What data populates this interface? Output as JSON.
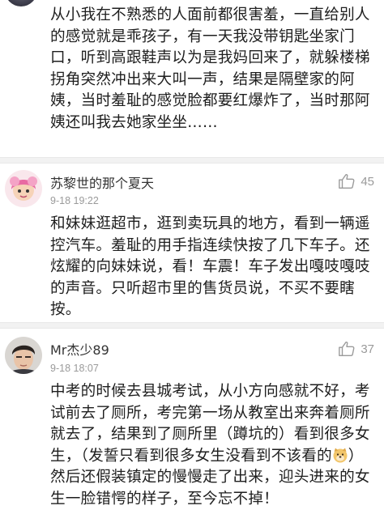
{
  "comments": [
    {
      "text": "从小我在不熟悉的人面前都很害羞，一直给别人的感觉就是乖孩子，有一天我没带钥匙坐家门口，听到高跟鞋声以为是我妈回来了，就躲楼梯拐角突然冲出来大叫一声，结果是隔壁家的阿姨，当时羞耻的感觉脸都要红爆炸了，当时那阿姨还叫我去她家坐坐……"
    },
    {
      "username": "苏黎世的那个夏天",
      "time": "9-18 19:22",
      "likes": "45",
      "text": "和妹妹逛超市，逛到卖玩具的地方，看到一辆遥控汽车。羞耻的用手指连续快按了几下车子。还炫耀的向妹妹说，看！车震！车子发出嘎吱嘎吱的声音。只听超市里的售货员说，不买不要瞎按。"
    },
    {
      "username": "Mr杰少89",
      "time": "9-18 18:07",
      "likes": "37",
      "text_before_emoji": "中考的时候去县城考试，从小方向感就不好，考试前去了厕所，考完第一场从教室出来奔着厕所就去了，结果到了厕所里（蹲坑的）看到很多女生，（发誓只看到很多女生没看到不该看的",
      "text_after_emoji": "）然后还假装镇定的慢慢走了出来，迎头进来的女生一脸错愕的样子，至今忘不掉！"
    }
  ],
  "icons": {
    "like": "thumbs-up-outline-icon",
    "emoji": "doge-emoji-icon"
  },
  "colors": {
    "text": "#1e1e1e",
    "meta": "#9a9a9a",
    "divider": "#f2f2f2"
  }
}
